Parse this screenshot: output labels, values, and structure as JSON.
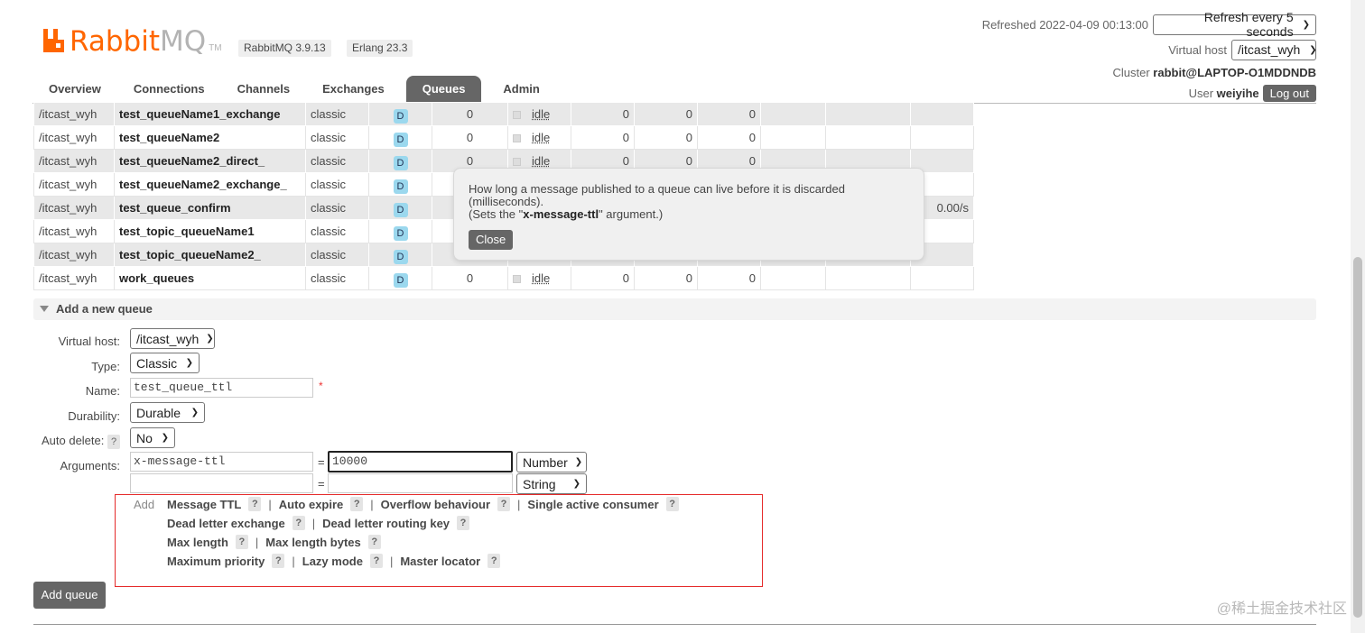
{
  "brand": {
    "name_part1": "Rabbit",
    "name_part2": "MQ",
    "tm": "TM",
    "version": "RabbitMQ 3.9.13",
    "erlang": "Erlang 23.3"
  },
  "header": {
    "refreshed": "Refreshed 2022-04-09 00:13:00",
    "refresh_select": "Refresh every 5 seconds",
    "vhost_label": "Virtual host",
    "vhost_select": "/itcast_wyh",
    "cluster_label": "Cluster",
    "cluster_name": "rabbit@LAPTOP-O1MDDNDB",
    "user_label": "User",
    "user_name": "weiyihe",
    "logout": "Log out"
  },
  "tabs": [
    "Overview",
    "Connections",
    "Channels",
    "Exchanges",
    "Queues",
    "Admin"
  ],
  "active_tab": "Queues",
  "queues": [
    {
      "vhost": "/itcast_wyh",
      "name": "test_queueName1_exchange",
      "type": "classic",
      "features": "D",
      "consumers": "0",
      "state": "idle",
      "ready": "0",
      "unacked": "0",
      "total": "0",
      "rate": ""
    },
    {
      "vhost": "/itcast_wyh",
      "name": "test_queueName2",
      "type": "classic",
      "features": "D",
      "consumers": "0",
      "state": "idle",
      "ready": "0",
      "unacked": "0",
      "total": "0",
      "rate": ""
    },
    {
      "vhost": "/itcast_wyh",
      "name": "test_queueName2_direct_",
      "type": "classic",
      "features": "D",
      "consumers": "0",
      "state": "idle",
      "ready": "0",
      "unacked": "0",
      "total": "0",
      "rate": ""
    },
    {
      "vhost": "/itcast_wyh",
      "name": "test_queueName2_exchange_",
      "type": "classic",
      "features": "D",
      "consumers": "",
      "state": "",
      "ready": "",
      "unacked": "",
      "total": "",
      "rate": ""
    },
    {
      "vhost": "/itcast_wyh",
      "name": "test_queue_confirm",
      "type": "classic",
      "features": "D",
      "consumers": "",
      "state": "",
      "ready": "",
      "unacked": "",
      "total": "",
      "rate": "0.00/s"
    },
    {
      "vhost": "/itcast_wyh",
      "name": "test_topic_queueName1",
      "type": "classic",
      "features": "D",
      "consumers": "",
      "state": "",
      "ready": "",
      "unacked": "",
      "total": "",
      "rate": ""
    },
    {
      "vhost": "/itcast_wyh",
      "name": "test_topic_queueName2_",
      "type": "classic",
      "features": "D",
      "consumers": "",
      "state": "",
      "ready": "",
      "unacked": "",
      "total": "",
      "rate": ""
    },
    {
      "vhost": "/itcast_wyh",
      "name": "work_queues",
      "type": "classic",
      "features": "D",
      "consumers": "0",
      "state": "idle",
      "ready": "0",
      "unacked": "0",
      "total": "0",
      "rate": ""
    }
  ],
  "popup": {
    "line1": "How long a message published to a queue can live before it is discarded",
    "line2": "(milliseconds).",
    "line3_pre": "(Sets the \"",
    "line3_key": "x-message-ttl",
    "line3_post": "\" argument.)",
    "close": "Close"
  },
  "add_queue": {
    "title": "Add a new queue",
    "vhost_label": "Virtual host:",
    "vhost_value": "/itcast_wyh",
    "type_label": "Type:",
    "type_value": "Classic",
    "name_label": "Name:",
    "name_value": "test_queue_ttl",
    "required_mark": "*",
    "durability_label": "Durability:",
    "durability_value": "Durable",
    "autodelete_label": "Auto delete:",
    "autodelete_value": "No",
    "arguments_label": "Arguments:",
    "arg1_key": "x-message-ttl",
    "arg1_value": "10000",
    "arg1_type": "Number",
    "arg2_key": "",
    "arg2_value": "",
    "arg2_type": "String",
    "eq": "=",
    "help": "?",
    "add_label": "Add",
    "helper_rows": [
      [
        "Message TTL",
        "Auto expire",
        "Overflow behaviour",
        "Single active consumer"
      ],
      [
        "Dead letter exchange",
        "Dead letter routing key"
      ],
      [
        "Max length",
        "Max length bytes"
      ],
      [
        "Maximum priority",
        "Lazy mode",
        "Master locator"
      ]
    ],
    "sep": "|",
    "submit": "Add queue"
  },
  "watermark": "@稀土掘金技术社区",
  "colors": {
    "brand_orange": "#ff6600",
    "active_tab": "#666666",
    "highlight_box": "#e52a2a",
    "durable_badge": "#9bd8ee"
  }
}
